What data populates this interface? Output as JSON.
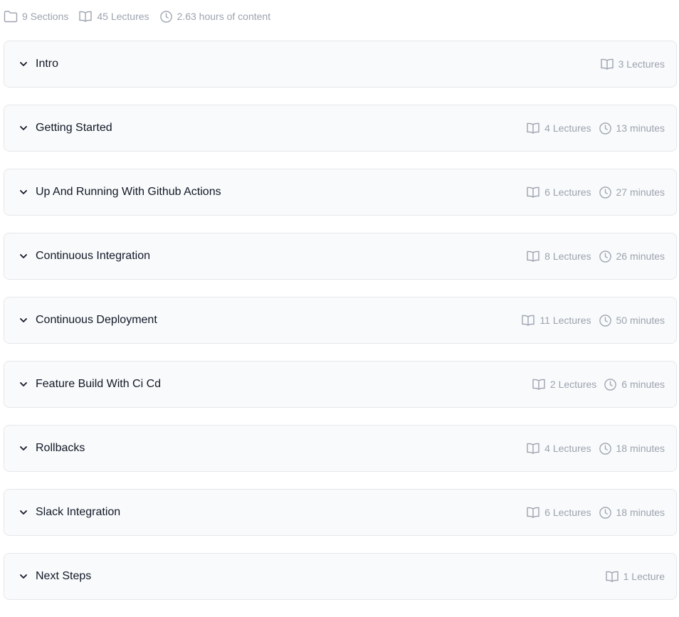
{
  "summary": {
    "sections": "9 Sections",
    "lectures": "45 Lectures",
    "hours": "2.63 hours of content"
  },
  "sections": [
    {
      "title": "Intro",
      "lectures": "3 Lectures",
      "duration": ""
    },
    {
      "title": "Getting Started",
      "lectures": "4 Lectures",
      "duration": "13 minutes"
    },
    {
      "title": "Up And Running With Github Actions",
      "lectures": "6 Lectures",
      "duration": "27 minutes"
    },
    {
      "title": "Continuous Integration",
      "lectures": "8 Lectures",
      "duration": "26 minutes"
    },
    {
      "title": "Continuous Deployment",
      "lectures": "11 Lectures",
      "duration": "50 minutes"
    },
    {
      "title": "Feature Build With Ci Cd",
      "lectures": "2 Lectures",
      "duration": "6 minutes"
    },
    {
      "title": "Rollbacks",
      "lectures": "4 Lectures",
      "duration": "18 minutes"
    },
    {
      "title": "Slack Integration",
      "lectures": "6 Lectures",
      "duration": "18 minutes"
    },
    {
      "title": "Next Steps",
      "lectures": "1 Lecture",
      "duration": ""
    }
  ],
  "icons": {
    "folder": "folder-icon",
    "book": "book-open-icon",
    "clock": "clock-icon",
    "chevron": "chevron-down-icon"
  },
  "colors": {
    "muted_text": "#9ca3af",
    "title_text": "#111827",
    "card_bg": "#f9fafb",
    "card_border": "#e5e7eb"
  }
}
